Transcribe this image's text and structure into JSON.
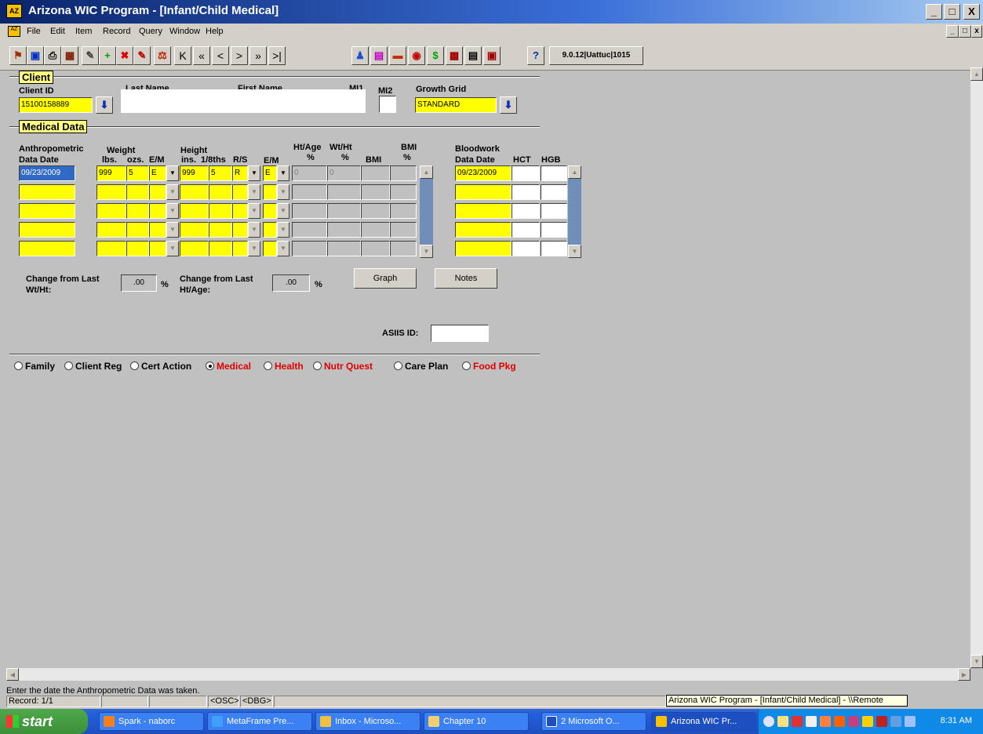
{
  "window": {
    "title": "Arizona WIC Program - [Infant/Child Medical]",
    "min": "_",
    "max": "□",
    "close": "X"
  },
  "menu": [
    "File",
    "Edit",
    "Item",
    "Record",
    "Query",
    "Window",
    "Help"
  ],
  "toolbar": {
    "version": "9.0.12|Uattuc|1015",
    "nav": [
      "K",
      "«",
      "<",
      ">",
      "»",
      ">|"
    ],
    "help": "?"
  },
  "client": {
    "section_label": "Client",
    "client_id_label": "Client ID",
    "client_id": "15100158889",
    "last_name_label": "Last Name",
    "first_name_label": "First Name",
    "mi1_label": "MI1",
    "mi2_label": "MI2",
    "growth_grid_label": "Growth Grid",
    "growth_grid": "STANDARD"
  },
  "medical": {
    "section_label": "Medical Data",
    "headers": {
      "anthro": "Anthropometric",
      "data_date": "Data Date",
      "weight": "Weight",
      "lbs": "lbs.",
      "ozs": "ozs.",
      "em": "E/M",
      "height": "Height",
      "ins": "ins.",
      "eighths": "1/8ths",
      "rs": "R/S",
      "em2": "E/M",
      "htage": "Ht/Age",
      "wtht": "Wt/Ht",
      "pct1": "%",
      "pct2": "%",
      "bmi": "BMI",
      "bmi_pct_a": "BMI",
      "bmi_pct_b": "%",
      "bloodwork": "Bloodwork",
      "bw_date": "Data Date",
      "hct": "HCT",
      "hgb": "HGB"
    },
    "row1": {
      "date": "09/23/2009",
      "lbs": "999",
      "ozs": "5",
      "em": "E",
      "ins": "999",
      "eighths": "5",
      "rs": "R",
      "em2": "E",
      "htage": "0",
      "wtht": "0",
      "bw_date": "09/23/2009"
    },
    "change_wt_label": "Change from Last Wt/Ht:",
    "change_wt": ".00",
    "change_ht_label": "Change from Last Ht/Age:",
    "change_ht": ".00",
    "pct": "%",
    "graph": "Graph",
    "notes": "Notes",
    "asiis_label": "ASIIS ID:"
  },
  "tabs": [
    "Family",
    "Client Reg",
    "Cert Action",
    "Medical",
    "Health",
    "Nutr Quest",
    "Care Plan",
    "Food Pkg"
  ],
  "status": {
    "hint": "Enter the date the Anthropometric Data was taken.",
    "record": "Record: 1/1",
    "osc": "<OSC>",
    "dbg": "<DBG>",
    "tooltip": "Arizona WIC Program - [Infant/Child Medical] - \\\\Remote"
  },
  "taskbar": {
    "start": "start",
    "tasks": [
      "Spark - naborc",
      "MetaFrame Pre...",
      "Inbox - Microso...",
      "Chapter 10",
      "2 Microsoft O...",
      "Arizona WIC Pr..."
    ],
    "clock": "8:31 AM"
  }
}
